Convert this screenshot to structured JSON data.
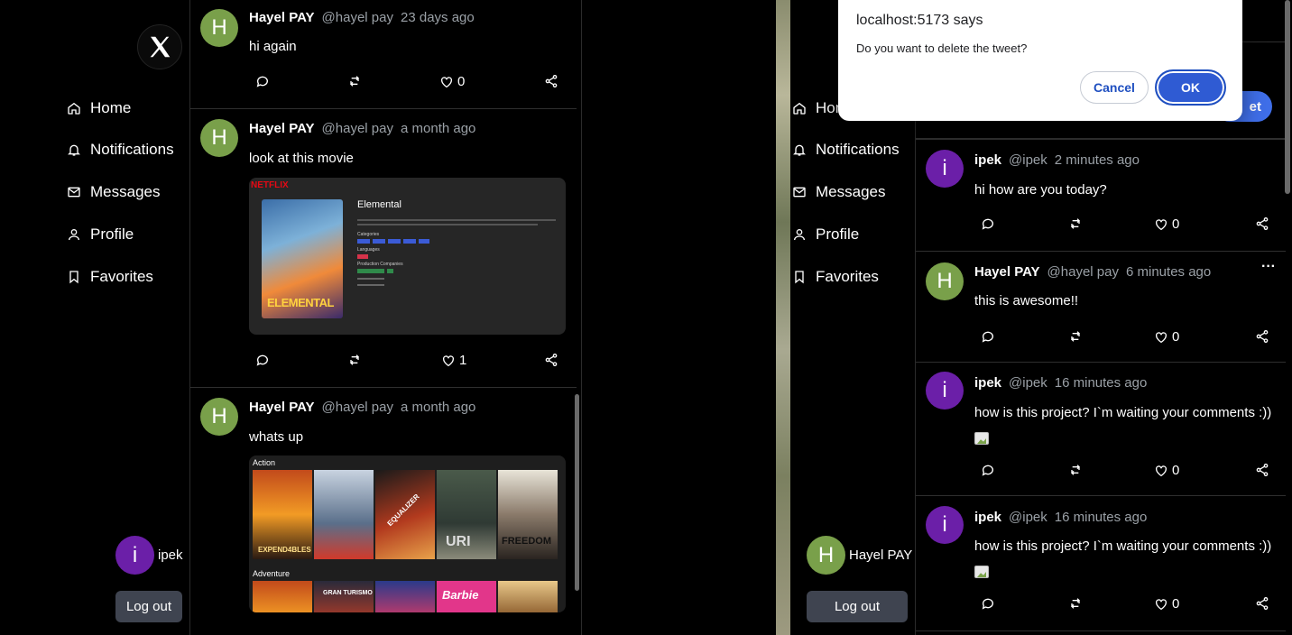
{
  "left_app": {
    "nav": [
      {
        "label": "Home",
        "icon": "home-icon"
      },
      {
        "label": "Notifications",
        "icon": "bell-icon"
      },
      {
        "label": "Messages",
        "icon": "mail-icon"
      },
      {
        "label": "Profile",
        "icon": "user-icon"
      },
      {
        "label": "Favorites",
        "icon": "bookmark-icon"
      }
    ],
    "current_user": {
      "initial": "i",
      "name": "ipek"
    },
    "logout_label": "Log out",
    "tweets": [
      {
        "initial": "H",
        "name": "Hayel PAY",
        "handle": "@hayel pay",
        "time": "23 days ago",
        "text": "hi again",
        "likes": "0"
      },
      {
        "initial": "H",
        "name": "Hayel PAY",
        "handle": "@hayel pay",
        "time": "a month ago",
        "text": "look at this movie",
        "likes": "1",
        "media": {
          "brand": "NETFLIX",
          "movie_title": "Elemental",
          "poster_text": "ELEMENTAL",
          "categories_label": "Categories",
          "languages_label": "Languages",
          "production_label": "Production Companies"
        }
      },
      {
        "initial": "H",
        "name": "Hayel PAY",
        "handle": "@hayel pay",
        "time": "a month ago",
        "text": "whats up",
        "media": {
          "row1_label": "Action",
          "row2_label": "Adventure",
          "posters_row1": [
            "EXPEND4BLES",
            "",
            "EQUALIZER",
            "URI",
            "FREEDOM"
          ],
          "posters_row2": [
            "",
            "GRAN TURISMO",
            "",
            "Barbie",
            ""
          ]
        }
      }
    ]
  },
  "right_app": {
    "nav": [
      {
        "label": "Hom",
        "icon": "home-icon"
      },
      {
        "label": "Notifications",
        "icon": "bell-icon"
      },
      {
        "label": "Messages",
        "icon": "mail-icon"
      },
      {
        "label": "Profile",
        "icon": "user-icon"
      },
      {
        "label": "Favorites",
        "icon": "bookmark-icon"
      }
    ],
    "tweet_button_partial": "et",
    "current_user": {
      "initial": "H",
      "name": "Hayel PAY"
    },
    "logout_label": "Log out",
    "tweets": [
      {
        "initial": "i",
        "name": "ipek",
        "handle": "@ipek",
        "time": "2 minutes ago",
        "text": "hi how are you today?",
        "likes": "0"
      },
      {
        "initial": "H",
        "name": "Hayel PAY",
        "handle": "@hayel pay",
        "time": "6 minutes ago",
        "text": "this is awesome!!",
        "likes": "0",
        "more": "···"
      },
      {
        "initial": "i",
        "name": "ipek",
        "handle": "@ipek",
        "time": "16 minutes ago",
        "text": "how is this project? I`m waiting your comments :))",
        "likes": "0"
      },
      {
        "initial": "i",
        "name": "ipek",
        "handle": "@ipek",
        "time": "16 minutes ago",
        "text": "how is this project? I`m waiting your comments :))",
        "likes": "0"
      }
    ]
  },
  "dialog": {
    "title": "localhost:5173 says",
    "message": "Do you want to delete the tweet?",
    "cancel_label": "Cancel",
    "ok_label": "OK"
  },
  "colors": {
    "accent": "#2f5bd3",
    "avatar_green": "#79a04a",
    "avatar_purple": "#6b1fa8"
  }
}
